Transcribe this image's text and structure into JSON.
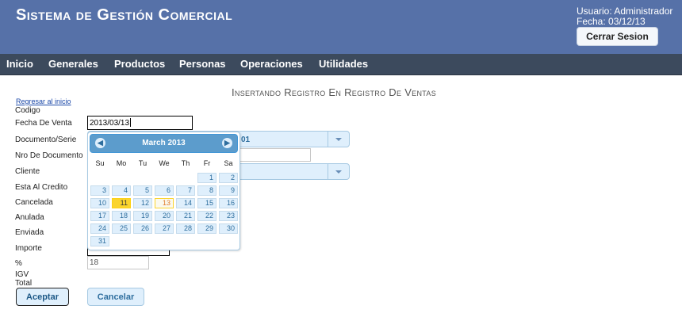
{
  "header": {
    "title": "Sistema de Gestión Comercial",
    "user_line": "Usuario: Administrador",
    "date_line": "Fecha: 03/12/13",
    "logout_label": "Cerrar Sesion"
  },
  "nav": {
    "items": [
      "Inicio",
      "Generales",
      "Productos",
      "Personas",
      "Operaciones",
      "Utilidades"
    ]
  },
  "page": {
    "title": "Insertando Registro En Registro De Ventas",
    "back_link": "Regresar al inicio"
  },
  "form": {
    "labels": {
      "codigo": "Codigo",
      "fecha": "Fecha De Venta",
      "documento": "Documento/Serie",
      "nro": "Nro De Documento",
      "cliente": "Cliente",
      "credito": "Esta Al Credito",
      "cancelada": "Cancelada",
      "anulada": "Anulada",
      "enviada": "Enviada",
      "importe": "Importe",
      "porcentaje": "%",
      "igv": "IGV",
      "total": "Total"
    },
    "fecha_value": "2013/03/13",
    "documento_text": "01",
    "porcentaje_value": "18",
    "accept_label": "Aceptar",
    "cancel_label": "Cancelar"
  },
  "datepicker": {
    "month_title": "March 2013",
    "weekdays": [
      "Su",
      "Mo",
      "Tu",
      "We",
      "Th",
      "Fr",
      "Sa"
    ],
    "today": 11,
    "selected": 13,
    "first_weekday": 5,
    "days_in_month": 31
  },
  "colors": {
    "header_bg": "#5671a8",
    "nav_bg": "#3c4a5d",
    "widget_blue": "#5c9ccc",
    "widget_light": "#dfeffc",
    "today_highlight": "#fad42e"
  }
}
